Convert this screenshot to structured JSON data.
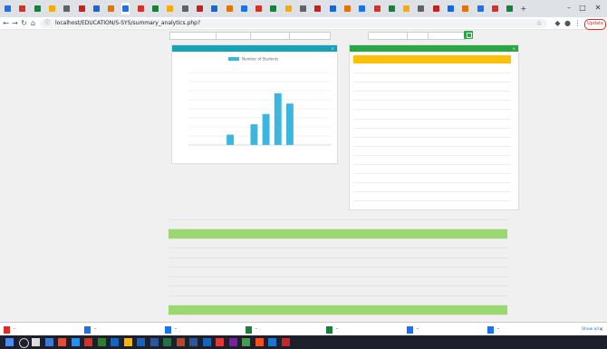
{
  "browser": {
    "tab_count": 35,
    "window_controls": [
      "–",
      "□",
      "✕"
    ],
    "url": "localhost/EDUCATION/S-SYS/summary_analytics.php?",
    "update_label": "Update"
  },
  "filters": {
    "items": [
      "",
      "",
      "",
      "",
      "",
      "",
      ""
    ]
  },
  "chart_card": {
    "title": "",
    "header_color": "#17a2b8",
    "legend": "Number of Students",
    "close": "×",
    "bar_color": "#3bb6e0"
  },
  "chart_data": {
    "type": "bar",
    "title": "",
    "categories": [
      "",
      "",
      "",
      "",
      "",
      "",
      "",
      "",
      "",
      "",
      "",
      ""
    ],
    "series": [
      {
        "name": "Number of Students",
        "values": [
          0,
          0,
          0,
          1,
          0,
          2,
          3,
          5,
          4,
          0,
          0,
          0
        ]
      }
    ],
    "ylim": [
      0,
      7
    ],
    "y_ticks": [
      "",
      "",
      "",
      "",
      "",
      "",
      "",
      "",
      ""
    ],
    "xlabel": "",
    "ylabel": "",
    "grid": true,
    "legend": "top"
  },
  "list_card": {
    "title": "",
    "header_color": "#28a745",
    "close": "×",
    "columns": [
      "",
      "",
      ""
    ],
    "rows": [
      {
        "id": "",
        "name": "",
        "score": ""
      },
      {
        "id": "",
        "name": "",
        "score": ""
      },
      {
        "id": "",
        "name": "",
        "score": ""
      },
      {
        "id": "",
        "name": "",
        "score": ""
      },
      {
        "id": "",
        "name": "",
        "score": ""
      },
      {
        "id": "",
        "name": "",
        "score": ""
      },
      {
        "id": "",
        "name": "",
        "score": ""
      },
      {
        "id": "",
        "name": "",
        "score": ""
      },
      {
        "id": "",
        "name": "",
        "score": ""
      },
      {
        "id": "",
        "name": "",
        "score": ""
      },
      {
        "id": "",
        "name": "",
        "score": ""
      },
      {
        "id": "",
        "name": "",
        "score": ""
      },
      {
        "id": "",
        "name": "",
        "score": ""
      },
      {
        "id": "",
        "name": "",
        "score": ""
      },
      {
        "id": "",
        "name": "",
        "score": ""
      },
      {
        "id": "",
        "name": "",
        "score": ""
      }
    ]
  },
  "summary_table": {
    "headers": [
      "",
      "",
      "",
      "",
      "",
      "",
      "",
      "",
      "",
      "",
      "",
      "",
      "",
      "",
      "",
      "",
      "",
      "",
      ""
    ],
    "rows": [
      {
        "cells": [
          "",
          "",
          "",
          "",
          "",
          "",
          "",
          "",
          "",
          "",
          "",
          "",
          "",
          "",
          "",
          "",
          "",
          "",
          ""
        ],
        "highlight": false
      },
      {
        "cells": [
          "",
          "",
          "",
          "",
          "",
          "",
          "",
          "",
          "",
          "",
          "",
          "",
          "",
          "",
          "",
          "",
          "",
          "",
          ""
        ],
        "highlight": true
      },
      {
        "cells": [
          "",
          "",
          "",
          "",
          "",
          "",
          "",
          "",
          "",
          "",
          "",
          "",
          "",
          "",
          "",
          "",
          "",
          "",
          ""
        ],
        "highlight": false
      },
      {
        "cells": [
          "",
          "",
          "",
          "",
          "",
          "",
          "",
          "",
          "",
          "",
          "",
          "",
          "",
          "",
          "",
          "",
          "",
          "",
          ""
        ],
        "highlight": false
      },
      {
        "cells": [
          "",
          "",
          "",
          "",
          "",
          "",
          "",
          "",
          "",
          "",
          "",
          "",
          "",
          "",
          "",
          "",
          "",
          "",
          ""
        ],
        "highlight": false
      },
      {
        "cells": [
          "",
          "",
          "",
          "",
          "",
          "",
          "",
          "",
          "",
          "",
          "",
          "",
          "",
          "",
          "",
          "",
          "",
          "",
          ""
        ],
        "highlight": false
      },
      {
        "cells": [
          "",
          "",
          "",
          "",
          "",
          "",
          "",
          "",
          "",
          "",
          "",
          "",
          "",
          "",
          "",
          "",
          "",
          "",
          ""
        ],
        "highlight": false
      },
      {
        "cells": [
          "",
          "",
          "",
          "",
          "",
          "",
          "",
          "",
          "",
          "",
          "",
          "",
          "",
          "",
          "",
          "",
          "",
          "",
          ""
        ],
        "highlight": false
      },
      {
        "cells": [
          "",
          "",
          "",
          "",
          "",
          "",
          "",
          "",
          "",
          "",
          "",
          "",
          "",
          "",
          "",
          "",
          "",
          "",
          ""
        ],
        "highlight": false
      },
      {
        "cells": [
          "",
          "",
          "",
          "",
          "",
          "",
          "",
          "",
          "",
          "",
          "",
          "",
          "",
          "",
          "",
          "",
          "",
          "",
          ""
        ],
        "highlight": true
      },
      {
        "cells": [
          "",
          "",
          "",
          "",
          "",
          "",
          "",
          "",
          "",
          "",
          "",
          "",
          "",
          "",
          "",
          "",
          "",
          "",
          ""
        ],
        "highlight": false
      }
    ]
  },
  "downloads": {
    "items": [
      "",
      "",
      "",
      "",
      "",
      "",
      ""
    ],
    "show_all": "Show all",
    "close": "×"
  },
  "taskbar": {
    "clock_time": "",
    "clock_date": ""
  }
}
